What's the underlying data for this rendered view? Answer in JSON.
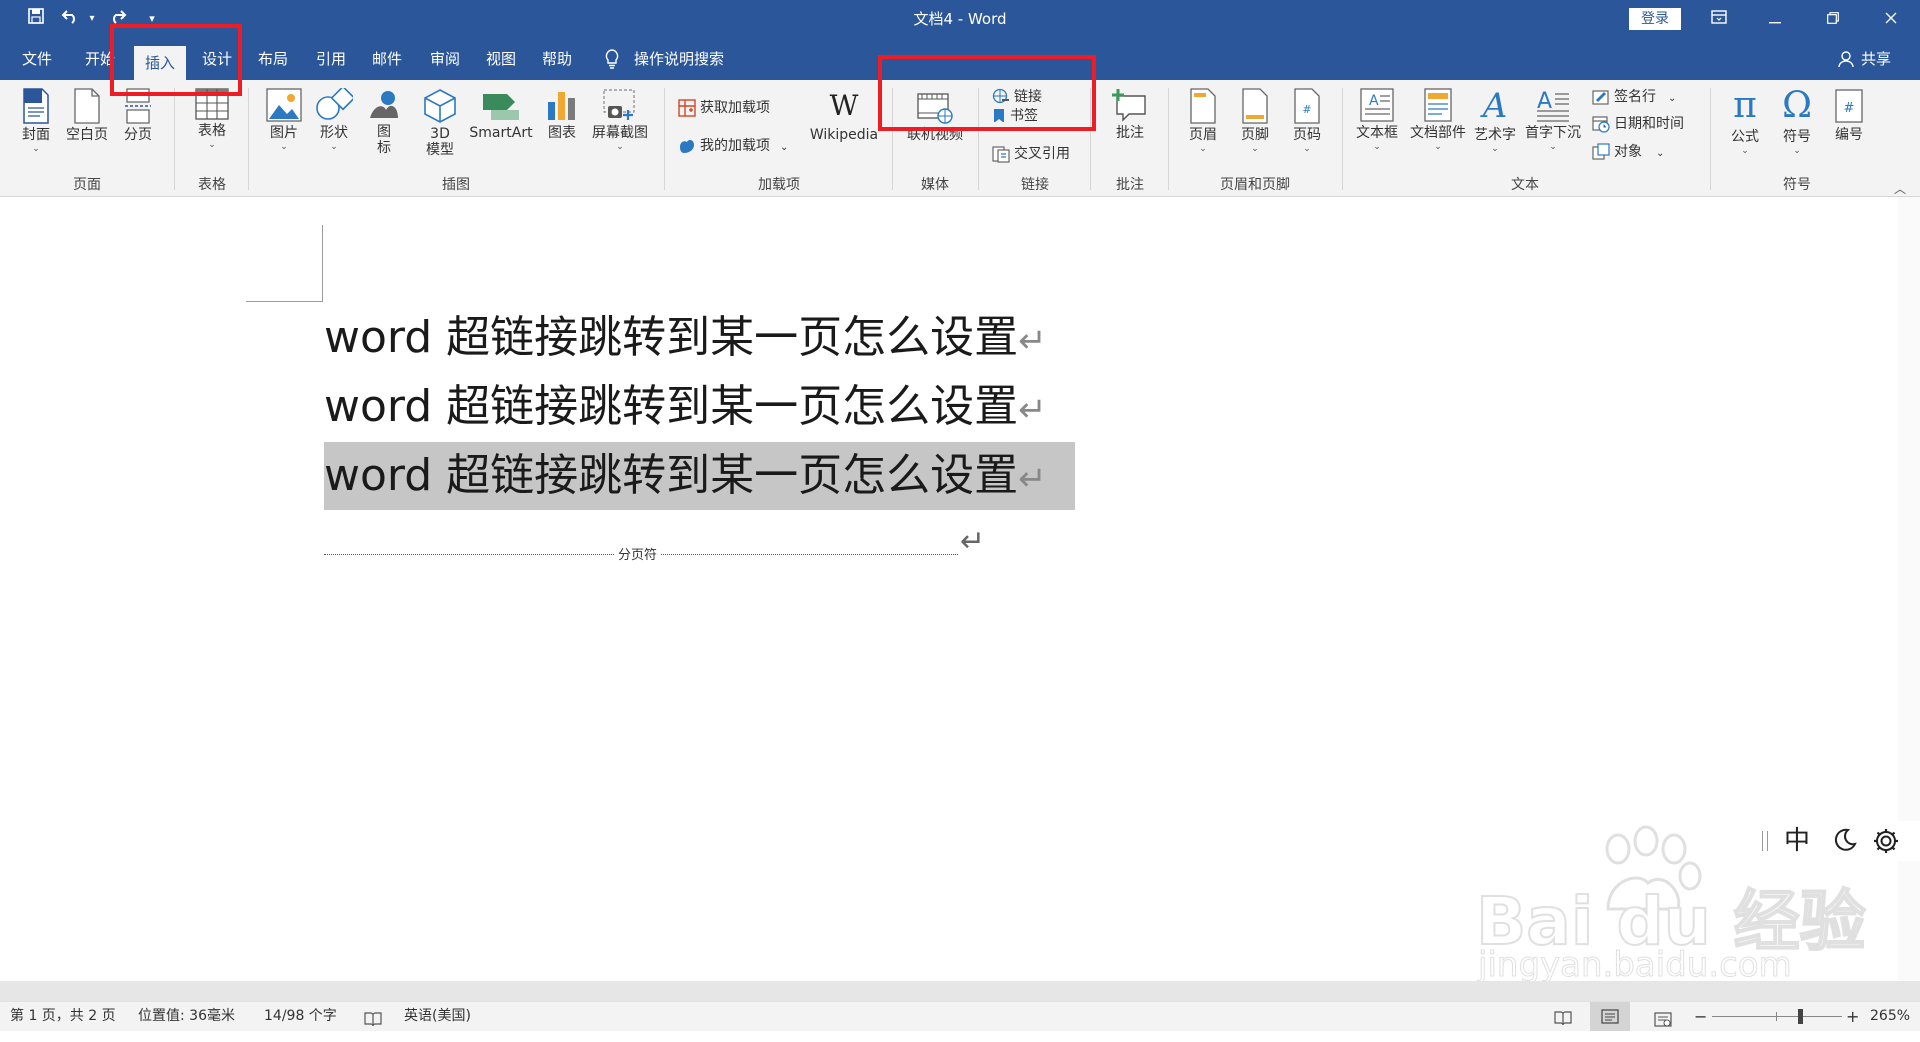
{
  "titlebar": {
    "title": "文档4  -  Word",
    "login_label": "登录",
    "qat": {
      "save_icon": "save-icon",
      "undo_icon": "undo-icon",
      "redo_icon": "redo-icon",
      "customize_icon": "customize-qat-icon"
    }
  },
  "tabs": {
    "file": "文件",
    "home": "开始",
    "insert": "插入",
    "design": "设计",
    "layout": "布局",
    "references": "引用",
    "mailings": "邮件",
    "review": "审阅",
    "view": "视图",
    "help": "帮助",
    "tell_me": "操作说明搜索",
    "share": "共享"
  },
  "ribbon": {
    "pages": {
      "cover": "封面",
      "blank": "空白页",
      "break": "分页",
      "group": "页面"
    },
    "tables": {
      "table": "表格",
      "group": "表格"
    },
    "illustrations": {
      "pictures": "图片",
      "shapes": "形状",
      "icons_line1": "图",
      "icons_line2": "标",
      "models_line1": "3D",
      "models_line2": "模型",
      "smartart": "SmartArt",
      "chart": "图表",
      "screenshot": "屏幕截图",
      "group": "插图"
    },
    "addins": {
      "get": "获取加载项",
      "my": "我的加载项",
      "wikipedia": "Wikipedia",
      "group": "加载项"
    },
    "media": {
      "online_video": "联机视频",
      "group": "媒体"
    },
    "links": {
      "link": "链接",
      "bookmark": "书签",
      "crossref": "交叉引用",
      "group": "链接"
    },
    "comments": {
      "comment": "批注",
      "group": "批注"
    },
    "header_footer": {
      "header": "页眉",
      "footer": "页脚",
      "page_number": "页码",
      "group": "页眉和页脚"
    },
    "text": {
      "textbox": "文本框",
      "quickparts": "文档部件",
      "wordart": "艺术字",
      "dropcap": "首字下沉",
      "signature": "签名行",
      "datetime": "日期和时间",
      "object": "对象",
      "group": "文本"
    },
    "symbols": {
      "equation": "公式",
      "symbol": "符号",
      "numbering": "编号",
      "group": "符号"
    }
  },
  "document": {
    "lines": [
      "word 超链接跳转到某一页怎么设置",
      "word 超链接跳转到某一页怎么设置",
      "word 超链接跳转到某一页怎么设置"
    ],
    "page_break_label": "分页符"
  },
  "ime_toolbar": {
    "mode": "中"
  },
  "watermark": {
    "logo_text": "Bai du 经验",
    "url": "jingyan.baidu.com"
  },
  "statusbar": {
    "page": "第 1 页，共 2 页",
    "position": "位置值: 36毫米",
    "words": "14/98 个字",
    "language": "英语(美国)",
    "zoom": "265%",
    "zoom_value": 265
  },
  "colors": {
    "brand": "#2b579a",
    "highlight": "#ee1c25",
    "selection": "#c6c6c6"
  }
}
